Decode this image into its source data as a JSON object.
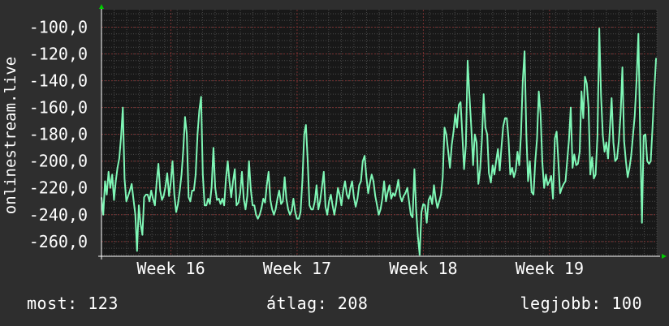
{
  "chart_data": {
    "type": "line",
    "ylabel": "onlinestream.live",
    "yticks": [
      -100,
      -120,
      -140,
      -160,
      -180,
      -200,
      -220,
      -240,
      -260
    ],
    "ytick_labels": [
      "-100,0",
      "-120,0",
      "-140,0",
      "-160,0",
      "-180,0",
      "-200,0",
      "-220,0",
      "-240,0",
      "-260,0"
    ],
    "ylim": [
      -271,
      -87
    ],
    "xlim": [
      0,
      4.4
    ],
    "xticks": [
      0.55,
      1.55,
      2.55,
      3.55
    ],
    "xtick_labels": [
      "Week 16",
      "Week 17",
      "Week 18",
      "Week 19"
    ],
    "grid": true,
    "line_color": "#7ff7b6",
    "series": [
      {
        "points": [
          [
            0.0,
            -227
          ],
          [
            0.014,
            -240
          ],
          [
            0.028,
            -215
          ],
          [
            0.042,
            -225
          ],
          [
            0.056,
            -208
          ],
          [
            0.07,
            -220
          ],
          [
            0.085,
            -210
          ],
          [
            0.099,
            -229
          ],
          [
            0.113,
            -215
          ],
          [
            0.127,
            -205
          ],
          [
            0.141,
            -198
          ],
          [
            0.155,
            -182
          ],
          [
            0.169,
            -160
          ],
          [
            0.183,
            -213
          ],
          [
            0.197,
            -230
          ],
          [
            0.211,
            -226
          ],
          [
            0.225,
            -222
          ],
          [
            0.239,
            -217
          ],
          [
            0.254,
            -229
          ],
          [
            0.268,
            -240
          ],
          [
            0.282,
            -267
          ],
          [
            0.296,
            -233
          ],
          [
            0.31,
            -247
          ],
          [
            0.324,
            -255
          ],
          [
            0.338,
            -227
          ],
          [
            0.352,
            -225
          ],
          [
            0.366,
            -225
          ],
          [
            0.38,
            -230
          ],
          [
            0.394,
            -222
          ],
          [
            0.408,
            -228
          ],
          [
            0.423,
            -233
          ],
          [
            0.437,
            -216
          ],
          [
            0.451,
            -202
          ],
          [
            0.465,
            -222
          ],
          [
            0.479,
            -229
          ],
          [
            0.493,
            -226
          ],
          [
            0.507,
            -219
          ],
          [
            0.521,
            -209
          ],
          [
            0.535,
            -226
          ],
          [
            0.549,
            -216
          ],
          [
            0.563,
            -200
          ],
          [
            0.577,
            -225
          ],
          [
            0.592,
            -238
          ],
          [
            0.606,
            -232
          ],
          [
            0.62,
            -222
          ],
          [
            0.634,
            -210
          ],
          [
            0.648,
            -192
          ],
          [
            0.662,
            -167
          ],
          [
            0.676,
            -180
          ],
          [
            0.69,
            -227
          ],
          [
            0.704,
            -230
          ],
          [
            0.718,
            -222
          ],
          [
            0.732,
            -222
          ],
          [
            0.746,
            -210
          ],
          [
            0.761,
            -180
          ],
          [
            0.775,
            -162
          ],
          [
            0.789,
            -152
          ],
          [
            0.803,
            -210
          ],
          [
            0.817,
            -233
          ],
          [
            0.831,
            -233
          ],
          [
            0.845,
            -228
          ],
          [
            0.859,
            -232
          ],
          [
            0.873,
            -219
          ],
          [
            0.887,
            -190
          ],
          [
            0.901,
            -220
          ],
          [
            0.915,
            -229
          ],
          [
            0.93,
            -228
          ],
          [
            0.944,
            -232
          ],
          [
            0.958,
            -228
          ],
          [
            0.972,
            -233
          ],
          [
            0.986,
            -213
          ],
          [
            1.0,
            -200
          ],
          [
            1.014,
            -215
          ],
          [
            1.028,
            -227
          ],
          [
            1.042,
            -215
          ],
          [
            1.056,
            -206
          ],
          [
            1.07,
            -233
          ],
          [
            1.085,
            -231
          ],
          [
            1.099,
            -224
          ],
          [
            1.113,
            -208
          ],
          [
            1.127,
            -228
          ],
          [
            1.141,
            -236
          ],
          [
            1.155,
            -226
          ],
          [
            1.169,
            -200
          ],
          [
            1.183,
            -221
          ],
          [
            1.197,
            -233
          ],
          [
            1.211,
            -233
          ],
          [
            1.225,
            -240
          ],
          [
            1.239,
            -243
          ],
          [
            1.254,
            -240
          ],
          [
            1.268,
            -235
          ],
          [
            1.282,
            -228
          ],
          [
            1.296,
            -231
          ],
          [
            1.31,
            -218
          ],
          [
            1.324,
            -208
          ],
          [
            1.338,
            -229
          ],
          [
            1.352,
            -236
          ],
          [
            1.366,
            -240
          ],
          [
            1.38,
            -236
          ],
          [
            1.394,
            -228
          ],
          [
            1.408,
            -222
          ],
          [
            1.423,
            -232
          ],
          [
            1.437,
            -230
          ],
          [
            1.451,
            -212
          ],
          [
            1.465,
            -228
          ],
          [
            1.479,
            -236
          ],
          [
            1.493,
            -240
          ],
          [
            1.507,
            -237
          ],
          [
            1.521,
            -228
          ],
          [
            1.535,
            -238
          ],
          [
            1.549,
            -243
          ],
          [
            1.563,
            -243
          ],
          [
            1.577,
            -238
          ],
          [
            1.592,
            -214
          ],
          [
            1.606,
            -180
          ],
          [
            1.62,
            -173
          ],
          [
            1.634,
            -200
          ],
          [
            1.648,
            -233
          ],
          [
            1.662,
            -236
          ],
          [
            1.676,
            -236
          ],
          [
            1.69,
            -230
          ],
          [
            1.704,
            -218
          ],
          [
            1.718,
            -236
          ],
          [
            1.732,
            -230
          ],
          [
            1.746,
            -220
          ],
          [
            1.761,
            -208
          ],
          [
            1.775,
            -234
          ],
          [
            1.789,
            -240
          ],
          [
            1.803,
            -230
          ],
          [
            1.817,
            -225
          ],
          [
            1.831,
            -233
          ],
          [
            1.845,
            -240
          ],
          [
            1.859,
            -232
          ],
          [
            1.873,
            -220
          ],
          [
            1.887,
            -225
          ],
          [
            1.901,
            -233
          ],
          [
            1.915,
            -222
          ],
          [
            1.93,
            -215
          ],
          [
            1.944,
            -225
          ],
          [
            1.958,
            -228
          ],
          [
            1.972,
            -220
          ],
          [
            1.986,
            -215
          ],
          [
            2.0,
            -227
          ],
          [
            2.014,
            -234
          ],
          [
            2.028,
            -228
          ],
          [
            2.042,
            -218
          ],
          [
            2.056,
            -215
          ],
          [
            2.07,
            -200
          ],
          [
            2.085,
            -196
          ],
          [
            2.099,
            -212
          ],
          [
            2.113,
            -224
          ],
          [
            2.127,
            -216
          ],
          [
            2.141,
            -210
          ],
          [
            2.155,
            -215
          ],
          [
            2.169,
            -226
          ],
          [
            2.183,
            -233
          ],
          [
            2.197,
            -240
          ],
          [
            2.211,
            -236
          ],
          [
            2.225,
            -228
          ],
          [
            2.239,
            -215
          ],
          [
            2.254,
            -230
          ],
          [
            2.268,
            -223
          ],
          [
            2.282,
            -218
          ],
          [
            2.296,
            -228
          ],
          [
            2.31,
            -224
          ],
          [
            2.324,
            -226
          ],
          [
            2.338,
            -221
          ],
          [
            2.352,
            -214
          ],
          [
            2.366,
            -226
          ],
          [
            2.38,
            -230
          ],
          [
            2.394,
            -226
          ],
          [
            2.408,
            -224
          ],
          [
            2.423,
            -220
          ],
          [
            2.437,
            -230
          ],
          [
            2.451,
            -240
          ],
          [
            2.465,
            -242
          ],
          [
            2.479,
            -206
          ],
          [
            2.493,
            -236
          ],
          [
            2.507,
            -256
          ],
          [
            2.521,
            -270
          ],
          [
            2.535,
            -238
          ],
          [
            2.549,
            -232
          ],
          [
            2.563,
            -233
          ],
          [
            2.577,
            -246
          ],
          [
            2.592,
            -229
          ],
          [
            2.606,
            -226
          ],
          [
            2.62,
            -232
          ],
          [
            2.634,
            -218
          ],
          [
            2.648,
            -228
          ],
          [
            2.662,
            -235
          ],
          [
            2.676,
            -230
          ],
          [
            2.69,
            -225
          ],
          [
            2.704,
            -212
          ],
          [
            2.718,
            -175
          ],
          [
            2.732,
            -180
          ],
          [
            2.746,
            -192
          ],
          [
            2.761,
            -205
          ],
          [
            2.775,
            -188
          ],
          [
            2.789,
            -178
          ],
          [
            2.803,
            -165
          ],
          [
            2.817,
            -175
          ],
          [
            2.831,
            -158
          ],
          [
            2.845,
            -156
          ],
          [
            2.859,
            -180
          ],
          [
            2.873,
            -206
          ],
          [
            2.887,
            -188
          ],
          [
            2.901,
            -125
          ],
          [
            2.915,
            -150
          ],
          [
            2.93,
            -175
          ],
          [
            2.944,
            -203
          ],
          [
            2.958,
            -180
          ],
          [
            2.972,
            -186
          ],
          [
            2.986,
            -217
          ],
          [
            3.0,
            -206
          ],
          [
            3.014,
            -185
          ],
          [
            3.028,
            -150
          ],
          [
            3.042,
            -175
          ],
          [
            3.056,
            -180
          ],
          [
            3.07,
            -209
          ],
          [
            3.085,
            -216
          ],
          [
            3.099,
            -203
          ],
          [
            3.113,
            -210
          ],
          [
            3.127,
            -200
          ],
          [
            3.141,
            -191
          ],
          [
            3.155,
            -207
          ],
          [
            3.169,
            -190
          ],
          [
            3.183,
            -174
          ],
          [
            3.197,
            -168
          ],
          [
            3.211,
            -168
          ],
          [
            3.225,
            -183
          ],
          [
            3.239,
            -210
          ],
          [
            3.254,
            -205
          ],
          [
            3.268,
            -212
          ],
          [
            3.282,
            -207
          ],
          [
            3.296,
            -193
          ],
          [
            3.31,
            -203
          ],
          [
            3.324,
            -180
          ],
          [
            3.338,
            -140
          ],
          [
            3.352,
            -118
          ],
          [
            3.366,
            -180
          ],
          [
            3.38,
            -215
          ],
          [
            3.394,
            -200
          ],
          [
            3.408,
            -223
          ],
          [
            3.423,
            -225
          ],
          [
            3.437,
            -200
          ],
          [
            3.451,
            -183
          ],
          [
            3.465,
            -148
          ],
          [
            3.479,
            -165
          ],
          [
            3.493,
            -201
          ],
          [
            3.507,
            -220
          ],
          [
            3.521,
            -210
          ],
          [
            3.535,
            -218
          ],
          [
            3.549,
            -215
          ],
          [
            3.563,
            -211
          ],
          [
            3.577,
            -228
          ],
          [
            3.592,
            -183
          ],
          [
            3.606,
            -178
          ],
          [
            3.62,
            -200
          ],
          [
            3.634,
            -224
          ],
          [
            3.648,
            -220
          ],
          [
            3.662,
            -217
          ],
          [
            3.676,
            -215
          ],
          [
            3.69,
            -200
          ],
          [
            3.704,
            -184
          ],
          [
            3.718,
            -160
          ],
          [
            3.732,
            -205
          ],
          [
            3.746,
            -195
          ],
          [
            3.761,
            -203
          ],
          [
            3.775,
            -202
          ],
          [
            3.789,
            -193
          ],
          [
            3.803,
            -148
          ],
          [
            3.817,
            -168
          ],
          [
            3.831,
            -137
          ],
          [
            3.845,
            -142
          ],
          [
            3.859,
            -160
          ],
          [
            3.873,
            -210
          ],
          [
            3.887,
            -197
          ],
          [
            3.901,
            -213
          ],
          [
            3.915,
            -210
          ],
          [
            3.93,
            -181
          ],
          [
            3.944,
            -101
          ],
          [
            3.958,
            -151
          ],
          [
            3.972,
            -181
          ],
          [
            3.986,
            -193
          ],
          [
            4.0,
            -186
          ],
          [
            4.014,
            -198
          ],
          [
            4.028,
            -176
          ],
          [
            4.042,
            -153
          ],
          [
            4.056,
            -186
          ],
          [
            4.07,
            -200
          ],
          [
            4.085,
            -198
          ],
          [
            4.099,
            -185
          ],
          [
            4.113,
            -165
          ],
          [
            4.127,
            -130
          ],
          [
            4.141,
            -185
          ],
          [
            4.155,
            -200
          ],
          [
            4.169,
            -212
          ],
          [
            4.183,
            -205
          ],
          [
            4.197,
            -196
          ],
          [
            4.211,
            -181
          ],
          [
            4.225,
            -166
          ],
          [
            4.239,
            -140
          ],
          [
            4.254,
            -105
          ],
          [
            4.268,
            -180
          ],
          [
            4.282,
            -246
          ],
          [
            4.296,
            -181
          ],
          [
            4.31,
            -180
          ],
          [
            4.324,
            -200
          ],
          [
            4.338,
            -202
          ],
          [
            4.352,
            -200
          ],
          [
            4.366,
            -175
          ],
          [
            4.38,
            -147
          ],
          [
            4.394,
            -123
          ]
        ]
      }
    ]
  },
  "stats": {
    "now": "most: 123",
    "avg": "átlag: 208",
    "best": "legjobb: 100"
  }
}
